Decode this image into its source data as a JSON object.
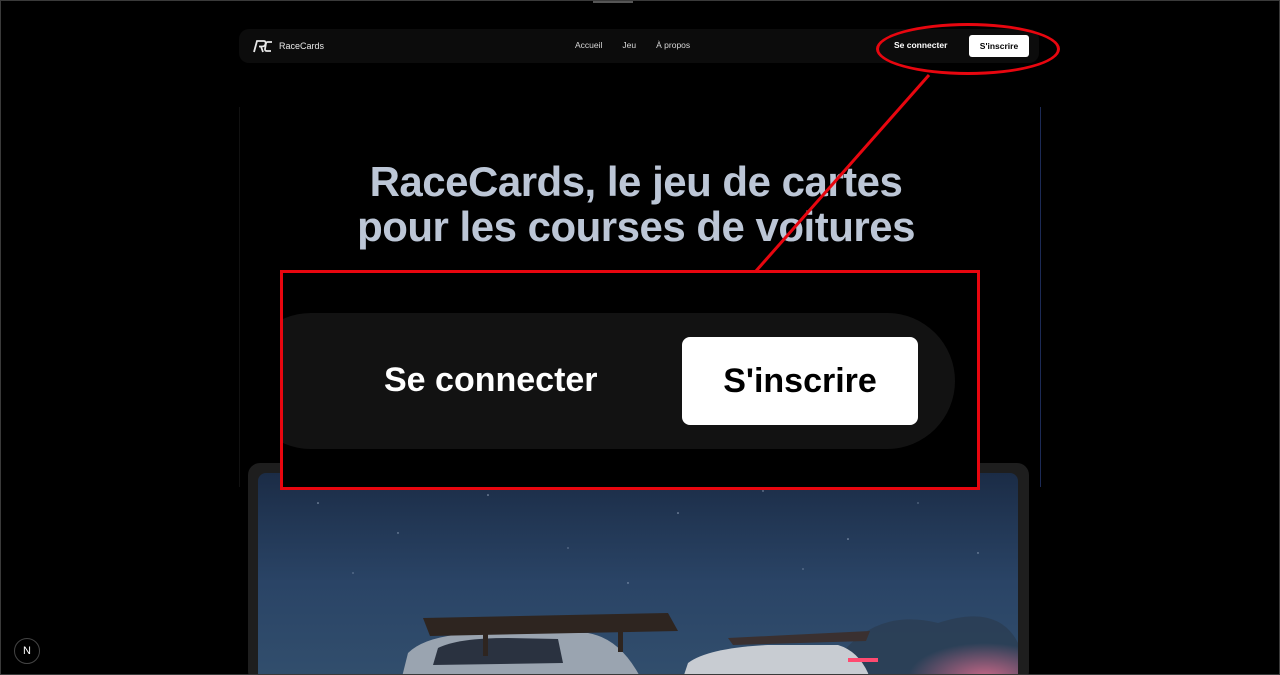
{
  "brand": {
    "name": "RaceCards",
    "logo_icon": "rc-logo-icon"
  },
  "nav": {
    "links": [
      {
        "label": "Accueil"
      },
      {
        "label": "Jeu"
      },
      {
        "label": "À propos"
      }
    ],
    "login_label": "Se connecter",
    "signup_label": "S'inscrire"
  },
  "hero": {
    "title": "RaceCards, le jeu de cartes pour les courses de voitures"
  },
  "zoom": {
    "login_label": "Se connecter",
    "signup_label": "S'inscrire"
  },
  "dev_indicator": {
    "label": "N"
  },
  "colors": {
    "background": "#000000",
    "annotation": "#e8060f",
    "title": "#bcc6d6",
    "button_bg": "#ffffff"
  }
}
